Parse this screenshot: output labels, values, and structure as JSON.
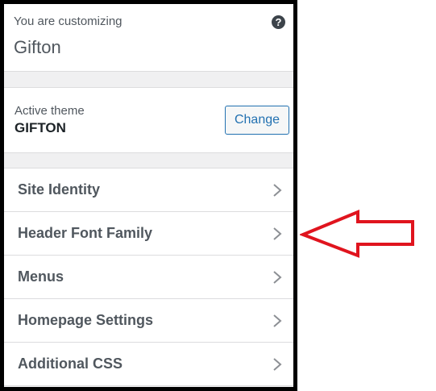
{
  "header": {
    "customizing_label": "You are customizing",
    "site_name": "Gifton",
    "help_icon": "?"
  },
  "theme": {
    "label": "Active theme",
    "name": "GIFTON",
    "change_label": "Change"
  },
  "menu": {
    "items": [
      {
        "label": "Site Identity",
        "icon": "chevron-right-icon"
      },
      {
        "label": "Header Font Family",
        "icon": "chevron-right-icon"
      },
      {
        "label": "Menus",
        "icon": "chevron-right-icon"
      },
      {
        "label": "Homepage Settings",
        "icon": "chevron-right-icon"
      },
      {
        "label": "Additional CSS",
        "icon": "chevron-right-icon"
      }
    ]
  },
  "annotation": {
    "arrow_color": "#e0141e",
    "points_to": "Header Font Family"
  },
  "colors": {
    "frame_border": "#000000",
    "accent": "#2271b1",
    "text": "#50575e",
    "background": "#f0f0f1"
  }
}
